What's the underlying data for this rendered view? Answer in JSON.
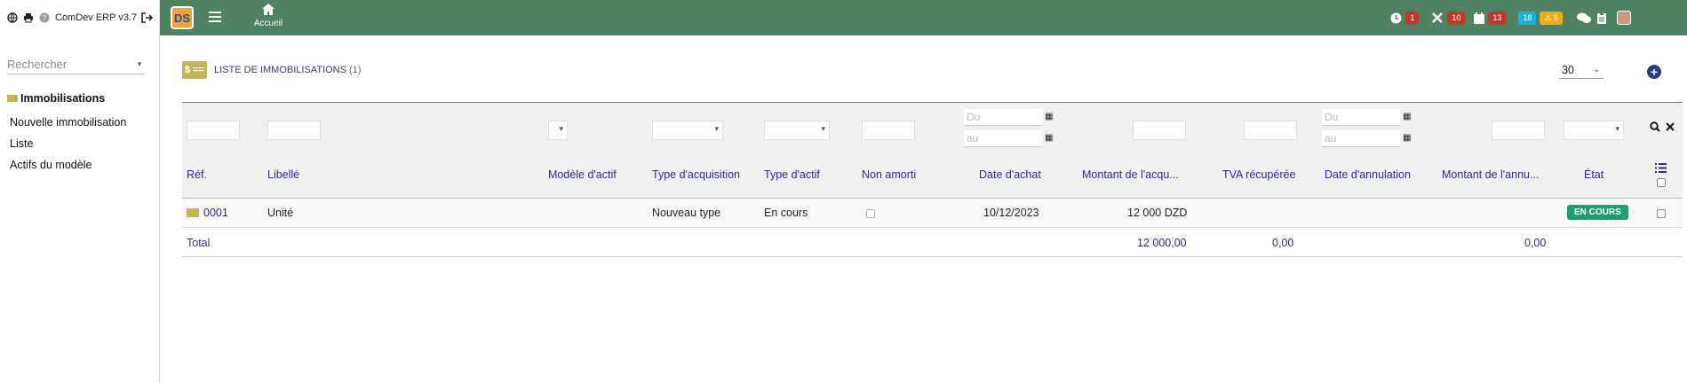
{
  "sidebar": {
    "version": "ComDev ERP v3.7",
    "search_placeholder": "Rechercher",
    "section": "Immobilisations",
    "items": [
      {
        "label": "Nouvelle immobilisation"
      },
      {
        "label": "Liste"
      },
      {
        "label": "Actifs du modèle"
      }
    ]
  },
  "topbar": {
    "logo_text": "DS",
    "home_label": "Accueil",
    "badges": [
      {
        "icon": "clock-icon",
        "count": "1"
      },
      {
        "icon": "tools-icon",
        "count": "10"
      },
      {
        "icon": "calendar-icon",
        "count": "13"
      },
      {
        "icon": "info-icon",
        "count": "18"
      },
      {
        "icon": "warning-icon",
        "count": "5"
      }
    ]
  },
  "page": {
    "title": "LISTE DE IMMOBILISATIONS",
    "count": "(1)",
    "per_page": "30"
  },
  "filters": {
    "date_from_placeholder": "Du",
    "date_to_placeholder": "au"
  },
  "columns": [
    "Réf.",
    "Libellé",
    "Modèle d'actif",
    "Type d'acquisition",
    "Type d'actif",
    "Non amorti",
    "Date d'achat",
    "Montant de l'acqu...",
    "TVA récupérée",
    "Date d'annulation",
    "Montant de l'annu...",
    "État"
  ],
  "rows": [
    {
      "ref": "0001",
      "libelle": "Unité",
      "modele": "",
      "type_acquisition": "Nouveau type",
      "type_actif": "En cours",
      "date_achat": "10/12/2023",
      "montant_acq": "12 000 DZD",
      "tva": "",
      "date_annulation": "",
      "montant_annul": "",
      "etat": "EN COURS"
    }
  ],
  "totals": {
    "label": "Total",
    "montant_acq": "12 000,00",
    "tva": "0,00",
    "montant_annul": "0,00"
  },
  "colors": {
    "topbar": "#4e8262",
    "status_badge": "#1f9d73",
    "accent": "#c5b357"
  }
}
